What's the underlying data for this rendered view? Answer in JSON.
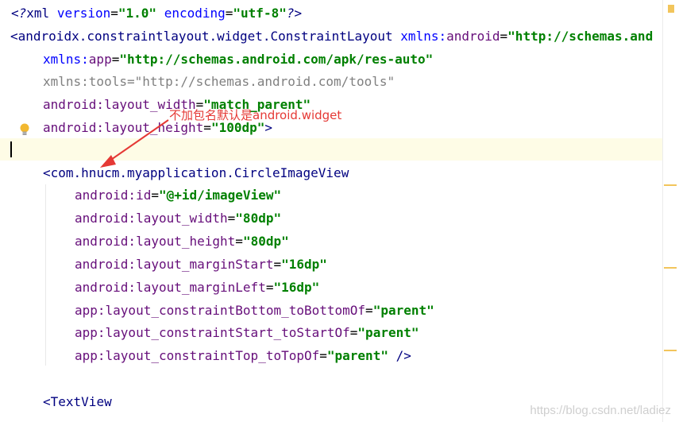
{
  "editor": {
    "lines": {
      "l1": {
        "decl_open": "<?",
        "decl_name": "xml",
        "a1": "version",
        "v1": "\"1.0\"",
        "a2": "encoding",
        "v2": "\"utf-8\"",
        "decl_close": "?>"
      },
      "l2": {
        "open": "<",
        "tag": "androidx.constraintlayout.widget.ConstraintLayout",
        "ns": "xmlns:",
        "attr": "android",
        "eq": "=",
        "val": "\"http://schemas.and"
      },
      "l3": {
        "ns": "xmlns:",
        "attr": "app",
        "eq": "=",
        "val": "\"http://schemas.android.com/apk/res-auto\""
      },
      "l4": {
        "text": "xmlns:tools=\"http://schemas.android.com/tools\""
      },
      "l5": {
        "ns": "android:",
        "attr": "layout_width",
        "eq": "=",
        "val": "\"match_parent\""
      },
      "l6": {
        "ns": "android:",
        "attr": "layout_height",
        "eq": "=",
        "val": "\"100dp\"",
        "close": ">"
      },
      "l8": {
        "open": "<",
        "tag": "com.hnucm.myapplication.CircleImageView"
      },
      "l9": {
        "ns": "android:",
        "attr": "id",
        "eq": "=",
        "val": "\"@+id/imageView\""
      },
      "l10": {
        "ns": "android:",
        "attr": "layout_width",
        "eq": "=",
        "val": "\"80dp\""
      },
      "l11": {
        "ns": "android:",
        "attr": "layout_height",
        "eq": "=",
        "val": "\"80dp\""
      },
      "l12": {
        "ns": "android:",
        "attr": "layout_marginStart",
        "eq": "=",
        "val": "\"16dp\""
      },
      "l13": {
        "ns": "android:",
        "attr": "layout_marginLeft",
        "eq": "=",
        "val": "\"16dp\""
      },
      "l14": {
        "ns": "app:",
        "attr": "layout_constraintBottom_toBottomOf",
        "eq": "=",
        "val": "\"parent\""
      },
      "l15": {
        "ns": "app:",
        "attr": "layout_constraintStart_toStartOf",
        "eq": "=",
        "val": "\"parent\""
      },
      "l16": {
        "ns": "app:",
        "attr": "layout_constraintTop_toTopOf",
        "eq": "=",
        "val": "\"parent\"",
        "close": " />"
      },
      "l18": {
        "open": "<",
        "tag": "TextView"
      }
    }
  },
  "annotation": {
    "text": "不加包名默认是android.widget",
    "color": "#e53935"
  },
  "watermark": {
    "text": "https://blog.csdn.net/ladiez"
  },
  "icons": {
    "intention": "lightbulb-icon"
  }
}
